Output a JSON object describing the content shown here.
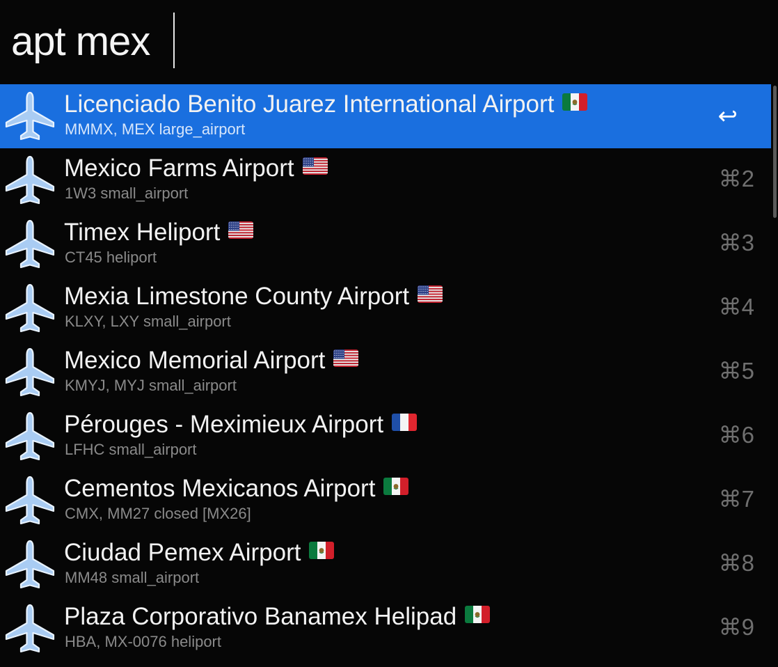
{
  "search": {
    "query": "apt mex"
  },
  "results": [
    {
      "title": "Licenciado Benito Juarez International Airport",
      "subtitle": "MMMX, MEX large_airport",
      "flag": "mexico",
      "shortcut": "↩",
      "selected": true
    },
    {
      "title": "Mexico Farms Airport",
      "subtitle": "1W3 small_airport",
      "flag": "usa",
      "shortcut": "⌘2"
    },
    {
      "title": "Timex Heliport",
      "subtitle": "CT45 heliport",
      "flag": "usa",
      "shortcut": "⌘3"
    },
    {
      "title": "Mexia Limestone County Airport",
      "subtitle": "KLXY, LXY small_airport",
      "flag": "usa",
      "shortcut": "⌘4"
    },
    {
      "title": "Mexico Memorial Airport",
      "subtitle": "KMYJ, MYJ small_airport",
      "flag": "usa",
      "shortcut": "⌘5"
    },
    {
      "title": "Pérouges - Meximieux Airport",
      "subtitle": "LFHC small_airport",
      "flag": "france",
      "shortcut": "⌘6"
    },
    {
      "title": "Cementos Mexicanos Airport",
      "subtitle": "CMX, MM27 closed [MX26]",
      "flag": "mexico",
      "shortcut": "⌘7"
    },
    {
      "title": "Ciudad Pemex Airport",
      "subtitle": "MM48 small_airport",
      "flag": "mexico",
      "shortcut": "⌘8"
    },
    {
      "title": "Plaza Corporativo Banamex Helipad",
      "subtitle": "HBA, MX-0076 heliport",
      "flag": "mexico",
      "shortcut": "⌘9"
    }
  ],
  "icons": {
    "result_icon": "airplane-icon"
  },
  "colors": {
    "selection": "#1a6fdf",
    "background": "#060606",
    "airplane": "#a9ccf3"
  }
}
